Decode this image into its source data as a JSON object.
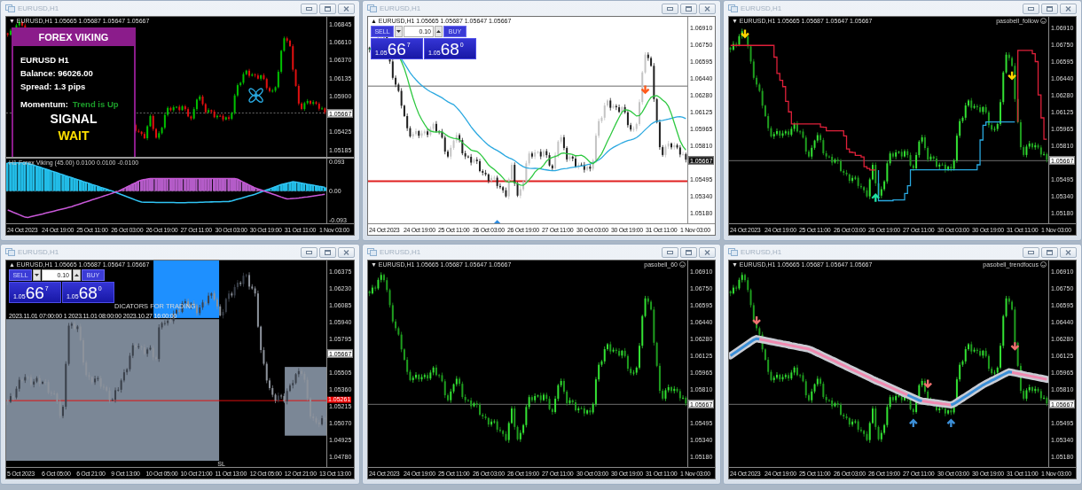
{
  "windows": [
    {
      "title": "EURUSD,H1",
      "kind": "viking",
      "menu_glyph": "▼",
      "header": "EURUSD,H1  1.05665 1.05687 1.05647 1.05667",
      "price_ticks": [
        "1.06845",
        "1.06610",
        "1.06370",
        "1.06135",
        "1.05900",
        "1.05425",
        "1.05185"
      ],
      "price_marks": [
        {
          "value": "1.05667",
          "kind": "current"
        }
      ],
      "signal_panel": {
        "title": "FOREX VIKING",
        "lines": [
          "EURUSD H1",
          "Balance: 96026.00",
          "Spread: 1.3 pips"
        ],
        "momentum_label": "Momentum:",
        "momentum_value": "Trend is Up",
        "signal_label": "SIGNAL",
        "signal_value": "WAIT"
      },
      "subwindow": {
        "label": "H1 Forex Viking (45.00) 0.0100 0.0100 -0.0100",
        "ticks": [
          "0.093",
          "0.00",
          "-0.093"
        ]
      },
      "time_labels": [
        "24 Oct 2023",
        "24 Oct 19:00",
        "25 Oct 11:00",
        "26 Oct 03:00",
        "26 Oct 19:00",
        "27 Oct 11:00",
        "30 Oct 03:00",
        "30 Oct 19:00",
        "31 Oct 11:00",
        "1 Nov 03:00"
      ]
    },
    {
      "title": "EURUSD,H1",
      "kind": "trade_ma",
      "menu_glyph": "▲",
      "header": "EURUSD,H1  1.05665 1.05687 1.05647 1.05667",
      "price_ticks": [
        "1.06910",
        "1.06750",
        "1.06595",
        "1.06440",
        "1.06280",
        "1.06125",
        "1.05965",
        "1.05810",
        "1.05495",
        "1.05340",
        "1.05180"
      ],
      "price_marks": [
        {
          "value": "1.05667",
          "kind": "current"
        }
      ],
      "trade_panel": {
        "sell": "SELL",
        "lot": "0.10",
        "buy": "BUY",
        "bid": {
          "prefix": "1.05",
          "big": "66",
          "small": "7"
        },
        "ask": {
          "prefix": "1.05",
          "big": "68",
          "small": "0"
        }
      },
      "time_labels": [
        "24 Oct 2023",
        "24 Oct 19:00",
        "25 Oct 11:00",
        "26 Oct 03:00",
        "26 Oct 19:00",
        "27 Oct 11:00",
        "30 Oct 03:00",
        "30 Oct 19:00",
        "31 Oct 11:00",
        "1 Nov 03:00"
      ]
    },
    {
      "title": "EURUSD,H1",
      "kind": "follow",
      "menu_glyph": "▼",
      "header": "EURUSD,H1  1.05665 1.05687 1.05647 1.05667",
      "indicator": "pasobell_follow",
      "price_ticks": [
        "1.06910",
        "1.06750",
        "1.06595",
        "1.06440",
        "1.06280",
        "1.06125",
        "1.05965",
        "1.05810",
        "1.05495",
        "1.05340",
        "1.05180"
      ],
      "price_marks": [
        {
          "value": "1.05667",
          "kind": "current"
        }
      ],
      "time_labels": [
        "24 Oct 2023",
        "24 Oct 19:00",
        "25 Oct 11:00",
        "26 Oct 03:00",
        "26 Oct 19:00",
        "27 Oct 11:00",
        "30 Oct 03:00",
        "30 Oct 19:00",
        "31 Oct 11:00",
        "1 Nov 03:00"
      ]
    },
    {
      "title": "EURUSD,H1",
      "kind": "zones",
      "menu_glyph": "▲",
      "header": "EURUSD,H1  1.05665 1.05687 1.05647 1.05667",
      "price_ticks": [
        "1.06375",
        "1.06230",
        "1.06085",
        "1.05940",
        "1.05795",
        "1.05505",
        "1.05360",
        "1.05215",
        "1.05070",
        "1.04925",
        "1.04780"
      ],
      "price_marks": [
        {
          "value": "1.05667",
          "kind": "current"
        },
        {
          "value": "1.05261",
          "kind": "alert"
        }
      ],
      "trade_panel": {
        "sell": "SELL",
        "lot": "0.10",
        "buy": "BUY",
        "bid": {
          "prefix": "1.05",
          "big": "66",
          "small": "7"
        },
        "ask": {
          "prefix": "1.05",
          "big": "68",
          "small": "0"
        }
      },
      "banner": "DICATORS FOR TRADING",
      "times_line": "2023.11.01 07:00:00 1 2023.11.01 08:00:00 2023.10.27 16:00:00",
      "sl_label": "SL",
      "time_labels": [
        "5 Oct 2023",
        "6 Oct 05:00",
        "6 Oct 21:00",
        "9 Oct 13:00",
        "10 Oct 05:00",
        "10 Oct 21:00",
        "11 Oct 13:00",
        "12 Oct 05:00",
        "12 Oct 21:00",
        "13 Oct 13:00"
      ]
    },
    {
      "title": "EURUSD,H1",
      "kind": "plain",
      "menu_glyph": "▼",
      "header": "EURUSD,H1  1.05665 1.05687 1.05647 1.05667",
      "indicator": "pasobell_60",
      "price_ticks": [
        "1.06910",
        "1.06750",
        "1.06595",
        "1.06440",
        "1.06280",
        "1.06125",
        "1.05965",
        "1.05810",
        "1.05495",
        "1.05340",
        "1.05180"
      ],
      "price_marks": [
        {
          "value": "1.05667",
          "kind": "current"
        }
      ],
      "time_labels": [
        "24 Oct 2023",
        "24 Oct 19:00",
        "25 Oct 11:00",
        "26 Oct 03:00",
        "26 Oct 19:00",
        "27 Oct 11:00",
        "30 Oct 03:00",
        "30 Oct 19:00",
        "31 Oct 11:00",
        "1 Nov 03:00"
      ]
    },
    {
      "title": "EURUSD,H1",
      "kind": "trendfocus",
      "menu_glyph": "▼",
      "header": "EURUSD,H1  1.05665 1.05687 1.05647 1.05667",
      "indicator": "pasobell_trendfocus",
      "price_ticks": [
        "1.06910",
        "1.06750",
        "1.06595",
        "1.06440",
        "1.06280",
        "1.06125",
        "1.05965",
        "1.05810",
        "1.05495",
        "1.05340",
        "1.05180"
      ],
      "price_marks": [
        {
          "value": "1.05667",
          "kind": "current"
        }
      ],
      "time_labels": [
        "24 Oct 2023",
        "24 Oct 19:00",
        "25 Oct 11:00",
        "26 Oct 03:00",
        "26 Oct 19:00",
        "27 Oct 11:00",
        "30 Oct 03:00",
        "30 Oct 19:00",
        "31 Oct 11:00",
        "1 Nov 03:00"
      ]
    }
  ]
}
